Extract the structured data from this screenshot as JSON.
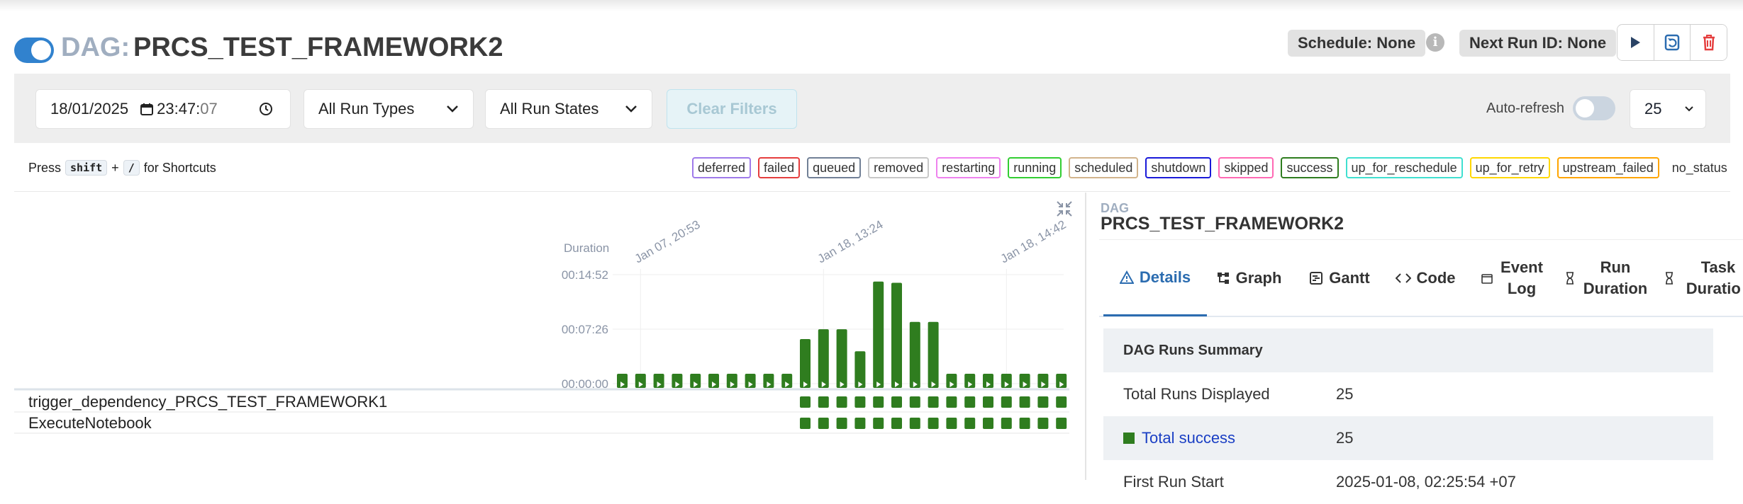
{
  "header": {
    "dag_prefix": "DAG:",
    "dag_title": "PRCS_TEST_FRAMEWORK2",
    "schedule": "Schedule: None",
    "next_run": "Next Run ID: None",
    "paused": false
  },
  "filters": {
    "date": "18/01/2025",
    "time_hm": "23:47:",
    "time_s": "07",
    "run_types": "All Run Types",
    "run_states": "All Run States",
    "clear": "Clear Filters",
    "autorefresh": "Auto-refresh",
    "num_runs": "25"
  },
  "shortcut": {
    "press": "Press",
    "key1": "shift",
    "plus": "+",
    "key2": "/",
    "suffix": "for Shortcuts"
  },
  "legend": [
    {
      "label": "deferred",
      "color": "#9f7aea"
    },
    {
      "label": "failed",
      "color": "#e53e3e"
    },
    {
      "label": "queued",
      "color": "#718096"
    },
    {
      "label": "removed",
      "color": "#c8c8c8"
    },
    {
      "label": "restarting",
      "color": "#ee82ee"
    },
    {
      "label": "running",
      "color": "#32cd32"
    },
    {
      "label": "scheduled",
      "color": "#d2b48c"
    },
    {
      "label": "shutdown",
      "color": "#1a1ad9"
    },
    {
      "label": "skipped",
      "color": "#ff69b4"
    },
    {
      "label": "success",
      "color": "#2f7d1f"
    },
    {
      "label": "up_for_reschedule",
      "color": "#40e0d0"
    },
    {
      "label": "up_for_retry",
      "color": "#ffd700"
    },
    {
      "label": "upstream_failed",
      "color": "#ffa500"
    },
    {
      "label": "no_status",
      "color": "transparent"
    }
  ],
  "chart_data": {
    "type": "bar",
    "ylabel": "Duration",
    "y_ticks": [
      "00:00:00",
      "00:07:26",
      "00:14:52"
    ],
    "ylim_seconds": [
      0,
      892
    ],
    "x_annotations": [
      "Jan 07, 20:53",
      "Jan 18, 13:24",
      "Jan 18, 14:42"
    ],
    "values_seconds": [
      0,
      0,
      0,
      0,
      0,
      0,
      0,
      0,
      0,
      0,
      400,
      480,
      480,
      300,
      870,
      860,
      540,
      540,
      0,
      0,
      0,
      0,
      0,
      0,
      0
    ],
    "status": "success",
    "bar_color": "#2f7d1f"
  },
  "tasks": [
    {
      "name": "trigger_dependency_PRCS_TEST_FRAMEWORK1",
      "first_run_index": 10
    },
    {
      "name": "ExecuteNotebook",
      "first_run_index": 10
    }
  ],
  "panel": {
    "small_label": "DAG",
    "dag_name": "PRCS_TEST_FRAMEWORK2",
    "tabs": [
      {
        "label": "Details",
        "icon": "warning-triangle-icon"
      },
      {
        "label": "Graph",
        "icon": "graph-icon"
      },
      {
        "label": "Gantt",
        "icon": "gantt-icon"
      },
      {
        "label": "Code",
        "icon": "code-icon"
      },
      {
        "label": "Event Log",
        "icon": "calendar-icon"
      },
      {
        "label": "Run Duration",
        "icon": "hourglass-icon"
      },
      {
        "label": "Task Duration",
        "icon": "hourglass-icon"
      }
    ],
    "summary_title": "DAG Runs Summary",
    "rows": [
      {
        "key": "Total Runs Displayed",
        "value": "25"
      },
      {
        "key": "Total success",
        "value": "25"
      },
      {
        "key": "First Run Start",
        "value": "2025-01-08, 02:25:54 +07"
      }
    ]
  }
}
